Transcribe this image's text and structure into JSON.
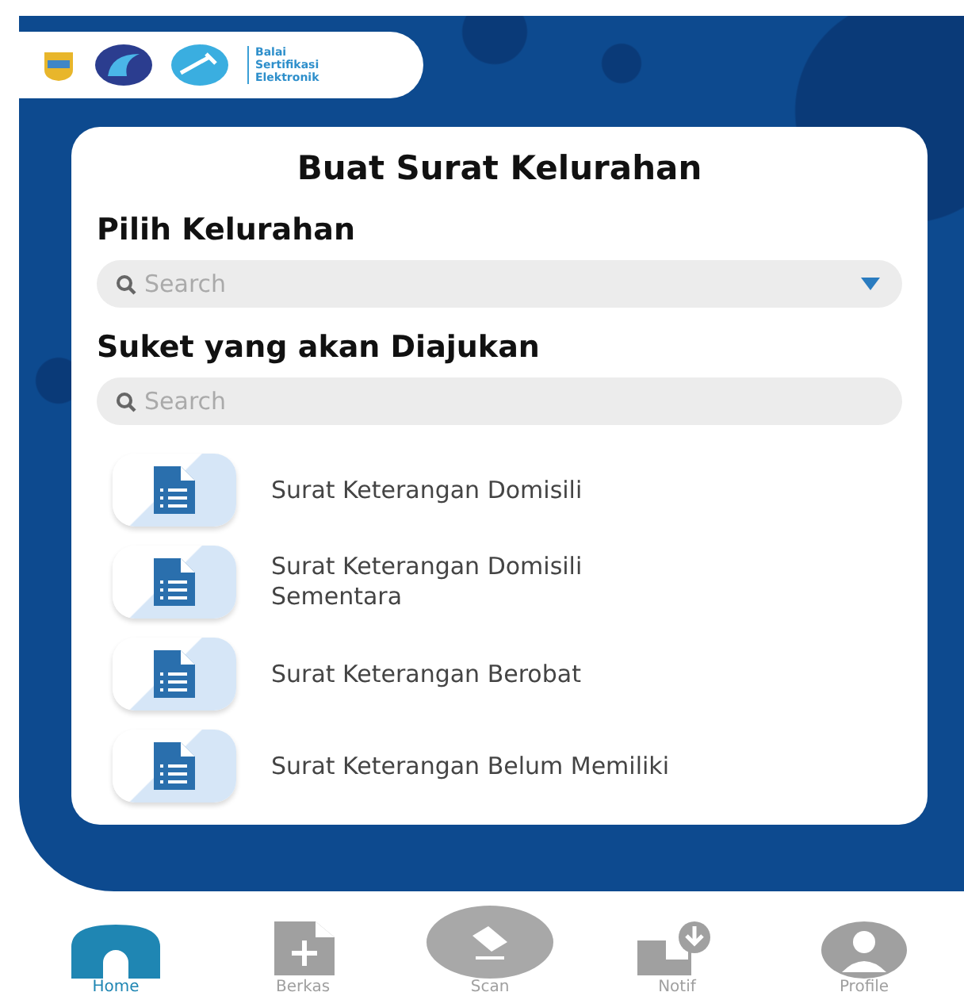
{
  "logo_text": [
    "Balai",
    "Sertifikasi",
    "Elektronik"
  ],
  "title": "Buat Surat Kelurahan",
  "kelurahan": {
    "label": "Pilih Kelurahan",
    "placeholder": "Search"
  },
  "suket": {
    "label": "Suket yang akan Diajukan",
    "placeholder": "Search"
  },
  "items": [
    {
      "label": "Surat Keterangan Domisili"
    },
    {
      "label": "Surat Keterangan Domisili Sementara"
    },
    {
      "label": "Surat Keterangan Berobat"
    },
    {
      "label": "Surat Keterangan Belum Memiliki"
    }
  ],
  "nav": [
    {
      "kind": "home",
      "label": "Home",
      "selected": true
    },
    {
      "kind": "file",
      "label": "Berkas",
      "selected": false
    },
    {
      "kind": "scan",
      "label": "Scan",
      "selected": false
    },
    {
      "kind": "inbox",
      "label": "Notif",
      "selected": false
    },
    {
      "kind": "profile",
      "label": "Profile",
      "selected": false
    }
  ]
}
